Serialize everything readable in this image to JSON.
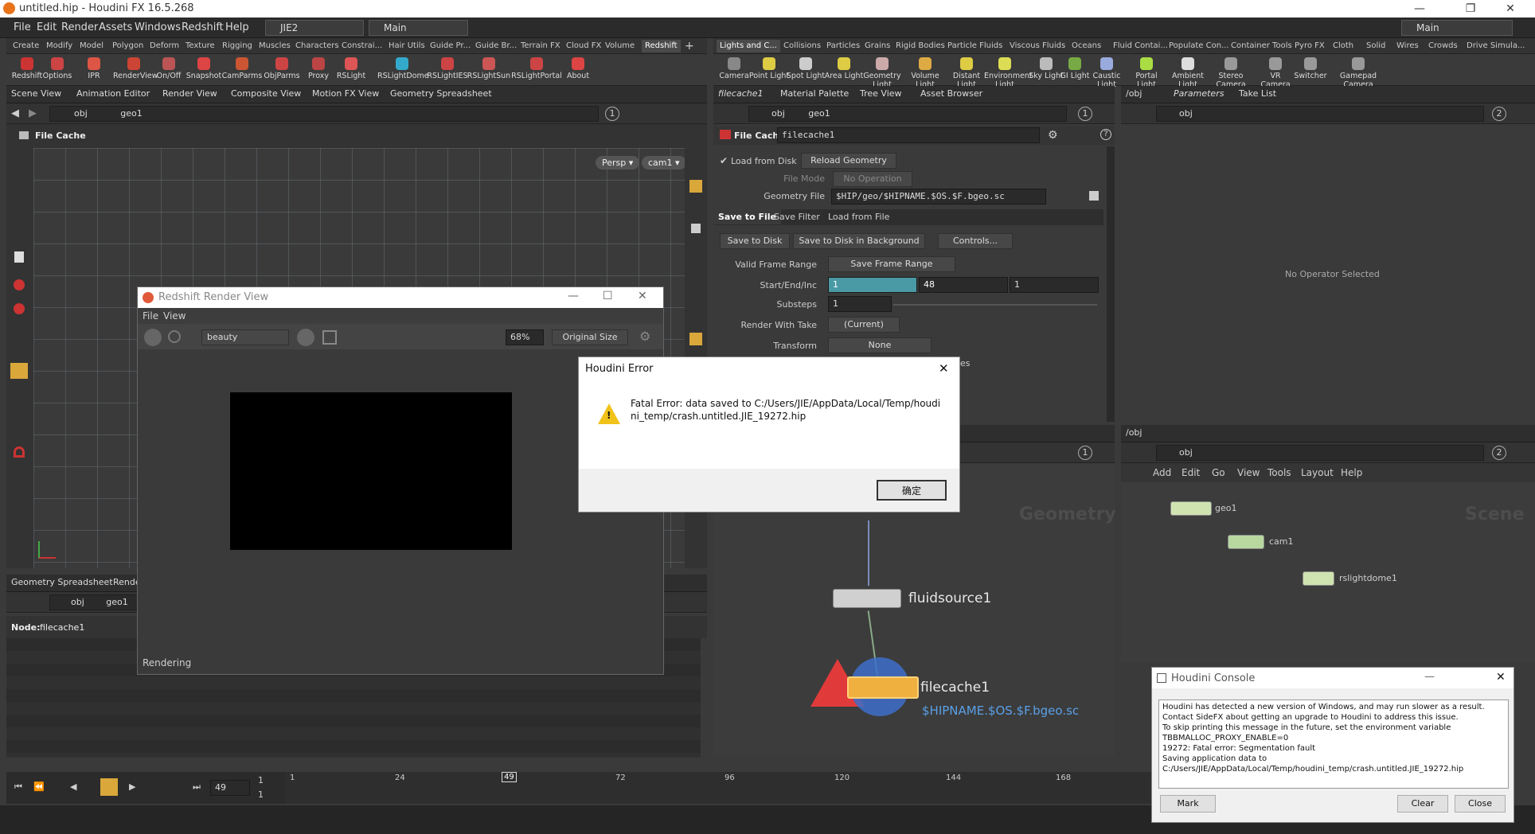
{
  "window": {
    "title": "untitled.hip - Houdini FX 16.5.268"
  },
  "menu": [
    "File",
    "Edit",
    "Render",
    "Assets",
    "Windows",
    "Redshift",
    "Help"
  ],
  "desktop": {
    "name": "JIE2",
    "layout": "Main",
    "right": "Main"
  },
  "shelf_left": {
    "tabs": [
      "Create",
      "Modify",
      "Model",
      "Polygon",
      "Deform",
      "Texture",
      "Rigging",
      "Muscles",
      "Characters",
      "Constrai...",
      "Hair Utils",
      "Guide Pr...",
      "Guide Br...",
      "Terrain FX",
      "Cloud FX",
      "Volume",
      "Redshift"
    ],
    "tools": [
      "Redshift",
      "Options",
      "IPR",
      "RenderView",
      "On/Off",
      "Snapshot",
      "CamParms",
      "ObjParms",
      "Proxy",
      "RSLight",
      "RSLightDome",
      "RSLightIES",
      "RSLightSun",
      "RSLightPortal",
      "About"
    ]
  },
  "shelf_right": {
    "tabs": [
      "Lights and C...",
      "Collisions",
      "Particles",
      "Grains",
      "Rigid Bodies",
      "Particle Fluids",
      "Viscous Fluids",
      "Oceans",
      "Fluid Contai...",
      "Populate Con...",
      "Container Tools",
      "Pyro FX",
      "Cloth",
      "Solid",
      "Wires",
      "Crowds",
      "Drive Simula..."
    ],
    "tools": [
      "Camera",
      "Point Light",
      "Spot Light",
      "Area Light",
      "Geometry Light",
      "Volume Light",
      "Distant Light",
      "Environment Light",
      "Sky Light",
      "GI Light",
      "Caustic Light",
      "Portal Light",
      "Ambient Light",
      "Stereo Camera",
      "VR Camera",
      "Switcher",
      "Gamepad Camera"
    ]
  },
  "left_pane": {
    "tabs": [
      "Scene View",
      "Animation Editor",
      "Render View",
      "Composite View",
      "Motion FX View",
      "Geometry Spreadsheet"
    ],
    "path": [
      "obj",
      "geo1"
    ],
    "title": "File Cache",
    "persp": "Persp",
    "cam": "cam1",
    "badge": "1"
  },
  "mid_pane": {
    "tabs": [
      "filecache1",
      "Material Palette",
      "Tree View",
      "Asset Browser"
    ],
    "path": [
      "obj",
      "geo1"
    ],
    "node_type": "File Cache",
    "node_name": "filecache1",
    "load_from_disk": "Load from Disk",
    "reload": "Reload Geometry",
    "file_mode_label": "File Mode",
    "file_mode": "No Operation",
    "geo_file_label": "Geometry File",
    "geo_file": "$HIP/geo/$HIPNAME.$OS.$F.bgeo.sc",
    "subtabs": [
      "Save to File",
      "Save Filter",
      "Load from File"
    ],
    "save_disk": "Save to Disk",
    "save_bg": "Save to Disk in Background",
    "controls": "Controls...",
    "valid_label": "Valid Frame Range",
    "valid": "Save Frame Range",
    "sei_label": "Start/End/Inc",
    "sei": [
      "1",
      "48",
      "1"
    ],
    "substeps_label": "Substeps",
    "substeps": "1",
    "take_label": "Render With Take",
    "take": "(Current)",
    "transform_label": "Transform",
    "transform": "None",
    "hidden_text": "es"
  },
  "right_pane": {
    "tabs": [
      "/obj",
      "Parameters",
      "Take List"
    ],
    "path": "obj",
    "empty": "No Operator Selected",
    "badge": "2"
  },
  "net_mid": {
    "watermark": "Geometry",
    "nodes": [
      {
        "name": "fluidsource1"
      },
      {
        "name": "filecache1",
        "sub": "$HIPNAME.$OS.$F.bgeo.sc"
      }
    ],
    "badge": "1"
  },
  "net_right": {
    "tab": "/obj",
    "path": "obj",
    "menu": [
      "Add",
      "Edit",
      "Go",
      "View",
      "Tools",
      "Layout",
      "Help"
    ],
    "watermark": "Scene",
    "nodes": [
      "geo1",
      "cam1",
      "rslightdome1"
    ],
    "badge": "2"
  },
  "spreadsheet": {
    "tabs": [
      "Geometry Spreadsheet",
      "Render"
    ],
    "path": [
      "obj",
      "geo1"
    ],
    "node_label": "Node:",
    "node": "filecache1"
  },
  "rs_window": {
    "title": "Redshift Render View",
    "menu": [
      "File",
      "View"
    ],
    "aov": "beauty",
    "zoom": "68%",
    "size": "Original Size",
    "status": "Rendering"
  },
  "error_dialog": {
    "title": "Houdini Error",
    "message": "Fatal Error: data saved to C:/Users/JIE/AppData/Local/Temp/houdini_temp/crash.untitled.JIE_19272.hip",
    "ok": "确定"
  },
  "console": {
    "title": "Houdini Console",
    "lines": [
      "Houdini has detected a new version of Windows, and may run slower as a result.",
      "Contact SideFX about getting an upgrade to Houdini to address this issue.",
      "To skip printing this message in the future, set the environment variable",
      "TBBMALLOC_PROXY_ENABLE=0",
      "19272: Fatal error: Segmentation fault",
      "Saving application data to",
      "C:/Users/JIE/AppData/Local/Temp/houdini_temp/crash.untitled.JIE_19272.hip"
    ],
    "mark": "Mark",
    "clear": "Clear",
    "close": "Close"
  },
  "timeline": {
    "frame": "49",
    "start": "1",
    "end": "1",
    "ticks": [
      "1",
      "24",
      "49",
      "72",
      "96",
      "120",
      "144",
      "168"
    ]
  }
}
